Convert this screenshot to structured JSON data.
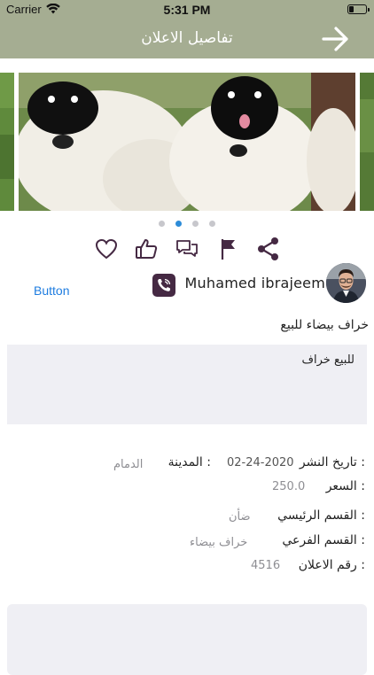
{
  "status_bar": {
    "carrier": "Carrier",
    "time": "5:31 PM",
    "battery_level": 0.3
  },
  "nav": {
    "title": "تفاصيل الاعلان",
    "back_icon": "arrow-right-icon"
  },
  "gallery": {
    "page_count": 4,
    "current_page": 2
  },
  "actions": [
    "share-icon",
    "flag-icon",
    "comments-icon",
    "like-icon",
    "favorite-icon"
  ],
  "seller": {
    "button_label": "Button",
    "name": "Muhamed ibrajeem"
  },
  "ad": {
    "title": "خراف بيضاء للبيع",
    "description": "للبيع خراف"
  },
  "details": {
    "publish_date_label": "تاريخ النشر :",
    "publish_date": "02-24-2020",
    "city_label": "المدينة :",
    "city": "الدمام",
    "price_label": "السعر :",
    "price": "250.0",
    "main_category_label": "القسم الرئيسي :",
    "main_category": "ضأن",
    "sub_category_label": "القسم الفرعي :",
    "sub_category": "خراف بيضاء",
    "ad_number_label": "رقم الاعلان :",
    "ad_number": "4516"
  },
  "colors": {
    "nav_bg": "#a5ad92",
    "accent": "#452943",
    "link": "#1f7de0",
    "dot_active": "#2d8cd8"
  }
}
